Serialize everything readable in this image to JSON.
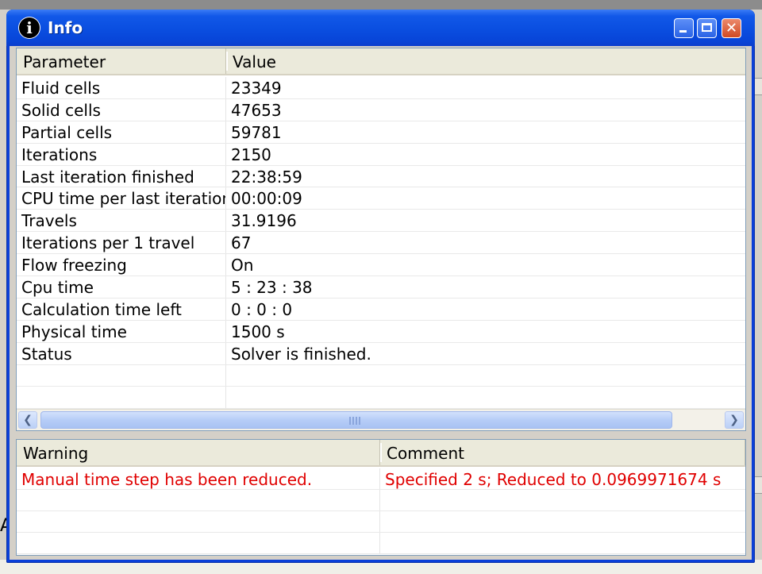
{
  "window": {
    "title": "Info"
  },
  "params": {
    "columns": [
      "Parameter",
      "Value"
    ],
    "rows": [
      {
        "p": "Fluid cells",
        "v": "23349"
      },
      {
        "p": "Solid cells",
        "v": "47653"
      },
      {
        "p": "Partial cells",
        "v": "59781"
      },
      {
        "p": "Iterations",
        "v": "2150"
      },
      {
        "p": "Last iteration finished",
        "v": "22:38:59"
      },
      {
        "p": "CPU time per last iteration",
        "v": "00:00:09"
      },
      {
        "p": "Travels",
        "v": "31.9196"
      },
      {
        "p": "Iterations per 1 travel",
        "v": "67"
      },
      {
        "p": "Flow freezing",
        "v": "On"
      },
      {
        "p": "Cpu time",
        "v": "5 : 23 : 38"
      },
      {
        "p": "Calculation time left",
        "v": "0 : 0 : 0"
      },
      {
        "p": "Physical time",
        "v": "1500 s"
      },
      {
        "p": "Status",
        "v": "Solver is finished."
      },
      {
        "p": "",
        "v": ""
      },
      {
        "p": "",
        "v": ""
      }
    ]
  },
  "warnings": {
    "columns": [
      "Warning",
      "Comment"
    ],
    "rows": [
      {
        "w": "Manual time step has been reduced.",
        "c": "Specified 2 s; Reduced to 0.0969971674 s"
      },
      {
        "w": "",
        "c": ""
      },
      {
        "w": "",
        "c": ""
      },
      {
        "w": "",
        "c": ""
      }
    ],
    "warning_color": "#e00000"
  },
  "icons": {
    "title": "info-icon",
    "minimize": "minimize-icon",
    "maximize": "maximize-icon",
    "close": "close-icon",
    "scroll_left": "chevron-left-icon",
    "scroll_right": "chevron-right-icon"
  },
  "background": {
    "stray_letter": "A"
  }
}
